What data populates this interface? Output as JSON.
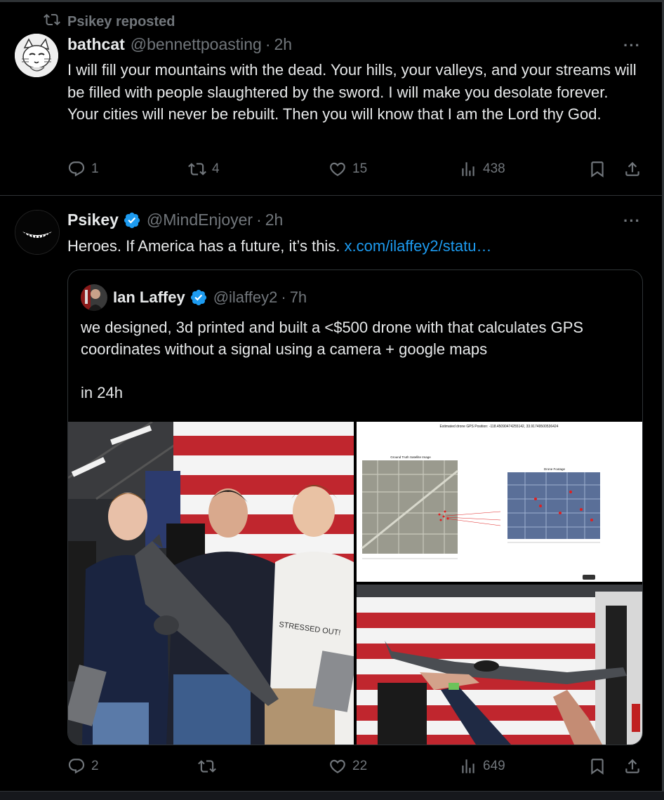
{
  "tweet1": {
    "repost_label": "Psikey reposted",
    "author_name": "bathcat",
    "author_handle": "@bennettpoasting",
    "separator": "·",
    "time": "2h",
    "more": "···",
    "text": "I will fill your mountains with the dead. Your hills, your valleys, and  your streams will be filled with people slaughtered by the sword. I  will make you desolate forever. Your cities will never be rebuilt. Then you will know that I am the Lord thy God.",
    "replies": "1",
    "reposts": "4",
    "likes": "15",
    "views": "438"
  },
  "tweet2": {
    "author_name": "Psikey",
    "author_handle": "@MindEnjoyer",
    "separator": "·",
    "time": "2h",
    "more": "···",
    "text": "Heroes. If America has a future, it’s this. ",
    "link_text": "x.com/ilaffey2/statu…",
    "replies": "2",
    "reposts": "",
    "likes": "22",
    "views": "649",
    "quote": {
      "author_name": "Ian Laffey",
      "author_handle": "@ilaffey2",
      "separator": "·",
      "time": "7h",
      "text_line1": "we designed, 3d printed and built a <$500 drone with that calculates GPS coordinates without a signal using a camera + google maps",
      "text_line2": "in 24h",
      "plot_title": "Estimated drone GPS Position: -118.45090474255142, 33.91749500536424",
      "plot_left_title": "Ground Truth Satellite Image",
      "plot_right_title": "Drone Footage",
      "shirt_text": "STRESSED OUT!"
    }
  },
  "colors": {
    "background": "#000000",
    "text": "#e7e9ea",
    "muted": "#71767b",
    "link": "#1d9bf0",
    "border": "#2f3336"
  }
}
